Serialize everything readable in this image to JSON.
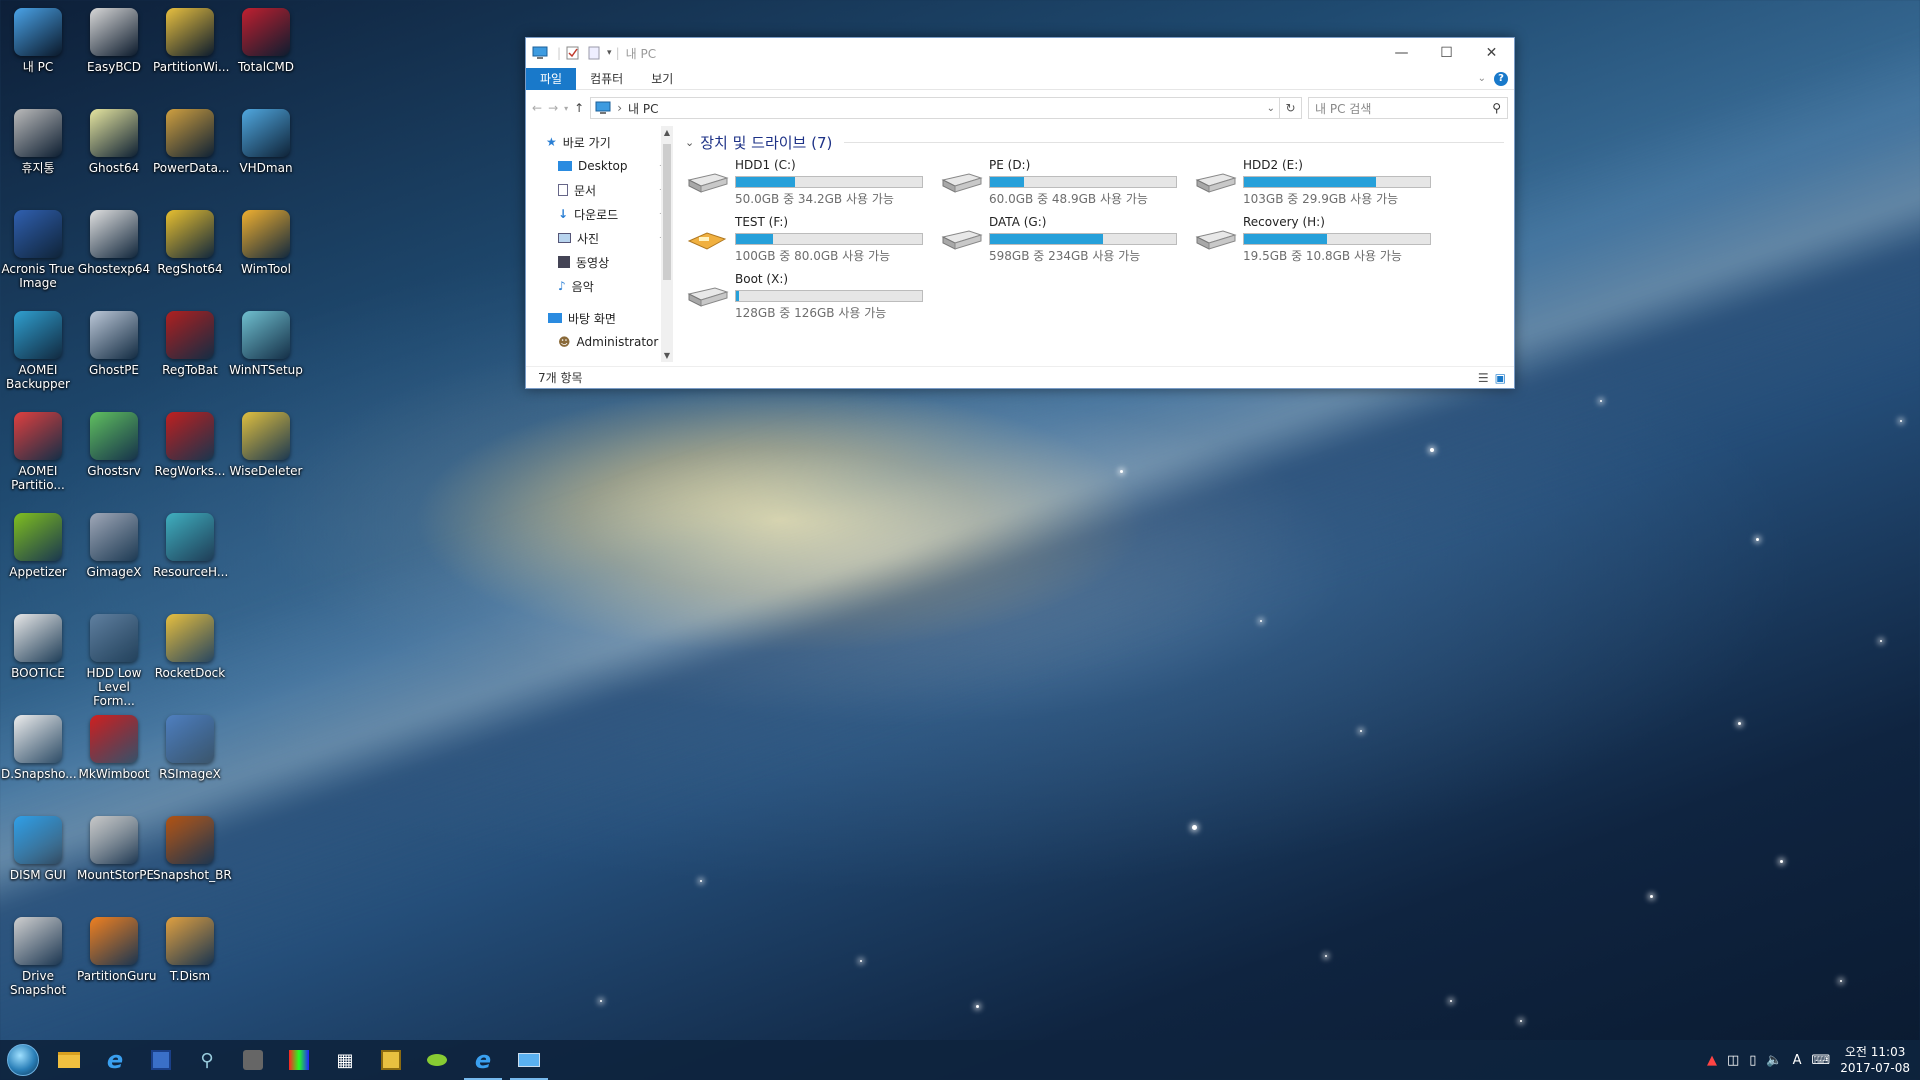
{
  "desktop": {
    "icons": [
      {
        "label": "내 PC",
        "icon": "computer-icon"
      },
      {
        "label": "EasyBCD",
        "icon": "easybcd-icon"
      },
      {
        "label": "PartitionWi...",
        "icon": "partitionwizard-icon"
      },
      {
        "label": "TotalCMD",
        "icon": "floppy-icon"
      },
      {
        "label": "휴지통",
        "icon": "recycle-bin-icon"
      },
      {
        "label": "Ghost64",
        "icon": "ghost-icon"
      },
      {
        "label": "PowerData...",
        "icon": "powerdata-icon"
      },
      {
        "label": "VHDman",
        "icon": "vhdman-icon"
      },
      {
        "label": "Acronis True Image",
        "icon": "acronis-icon"
      },
      {
        "label": "Ghostexp64",
        "icon": "ghostexp-icon"
      },
      {
        "label": "RegShot64",
        "icon": "regshot-icon"
      },
      {
        "label": "WimTool",
        "icon": "wimtool-icon"
      },
      {
        "label": "AOMEI Backupper",
        "icon": "aomei-backupper-icon"
      },
      {
        "label": "GhostPE",
        "icon": "ghostpe-icon"
      },
      {
        "label": "RegToBat",
        "icon": "regtobat-icon"
      },
      {
        "label": "WinNTSetup",
        "icon": "winntsetup-icon"
      },
      {
        "label": "AOMEI Partitio...",
        "icon": "aomei-partition-icon"
      },
      {
        "label": "Ghostsrv",
        "icon": "ghostsrv-icon"
      },
      {
        "label": "RegWorks...",
        "icon": "regworks-icon"
      },
      {
        "label": "WiseDeleter",
        "icon": "wisedeleter-icon"
      },
      {
        "label": "Appetizer",
        "icon": "appetizer-icon"
      },
      {
        "label": "GimageX",
        "icon": "gimagex-icon"
      },
      {
        "label": "ResourceH...",
        "icon": "resourcehacker-icon"
      },
      {
        "label": "BOOTICE",
        "icon": "bootice-icon"
      },
      {
        "label": "HDD Low Level Form...",
        "icon": "hdd-format-icon"
      },
      {
        "label": "RocketDock",
        "icon": "rocketdock-icon"
      },
      {
        "label": "D.Snapsho...",
        "icon": "dsnapshot-icon"
      },
      {
        "label": "MkWimboot",
        "icon": "ladybug-icon"
      },
      {
        "label": "RSImageX",
        "icon": "rsimagex-icon"
      },
      {
        "label": "DISM GUI",
        "icon": "windows-logo-icon"
      },
      {
        "label": "MountStorPE",
        "icon": "mountstorpe-icon"
      },
      {
        "label": "Snapshot_BR",
        "icon": "bridge-icon"
      },
      {
        "label": "Drive Snapshot",
        "icon": "drive-snapshot-icon"
      },
      {
        "label": "PartitionGuru",
        "icon": "partitionguru-icon"
      },
      {
        "label": "T.Dism",
        "icon": "tdism-icon"
      }
    ]
  },
  "explorer": {
    "title": "내 PC",
    "ribbon_tabs": [
      "파일",
      "컴퓨터",
      "보기"
    ],
    "address": "내 PC",
    "search_placeholder": "내 PC 검색",
    "nav": {
      "quick_access": "바로 가기",
      "items": [
        "Desktop",
        "문서",
        "다운로드",
        "사진",
        "동영상",
        "음악"
      ],
      "desktop": "바탕 화면",
      "user": "Administrator"
    },
    "group_header": "장치 및 드라이브 (7)",
    "drives": [
      {
        "name": "HDD1 (C:)",
        "free": "50.0GB 중 34.2GB 사용 가능",
        "used_fraction": 0.316
      },
      {
        "name": "PE (D:)",
        "free": "60.0GB 중 48.9GB 사용 가능",
        "used_fraction": 0.185
      },
      {
        "name": "HDD2 (E:)",
        "free": "103GB 중 29.9GB 사용 가능",
        "used_fraction": 0.71
      },
      {
        "name": "TEST (F:)",
        "free": "100GB 중 80.0GB 사용 가능",
        "used_fraction": 0.2
      },
      {
        "name": "DATA (G:)",
        "free": "598GB 중 234GB 사용 가능",
        "used_fraction": 0.609
      },
      {
        "name": "Recovery (H:)",
        "free": "19.5GB 중 10.8GB 사용 가능",
        "used_fraction": 0.446
      },
      {
        "name": "Boot (X:)",
        "free": "128GB 중 126GB 사용 가능",
        "used_fraction": 0.016
      }
    ],
    "status": "7개 항목"
  },
  "taskbar": {
    "clock_time": "오전 11:03",
    "clock_date": "2017-07-08",
    "ime": "A"
  },
  "colors": {
    "accent": "#1979ca",
    "drive_bar": "#26a0da",
    "header": "#1e3287"
  }
}
